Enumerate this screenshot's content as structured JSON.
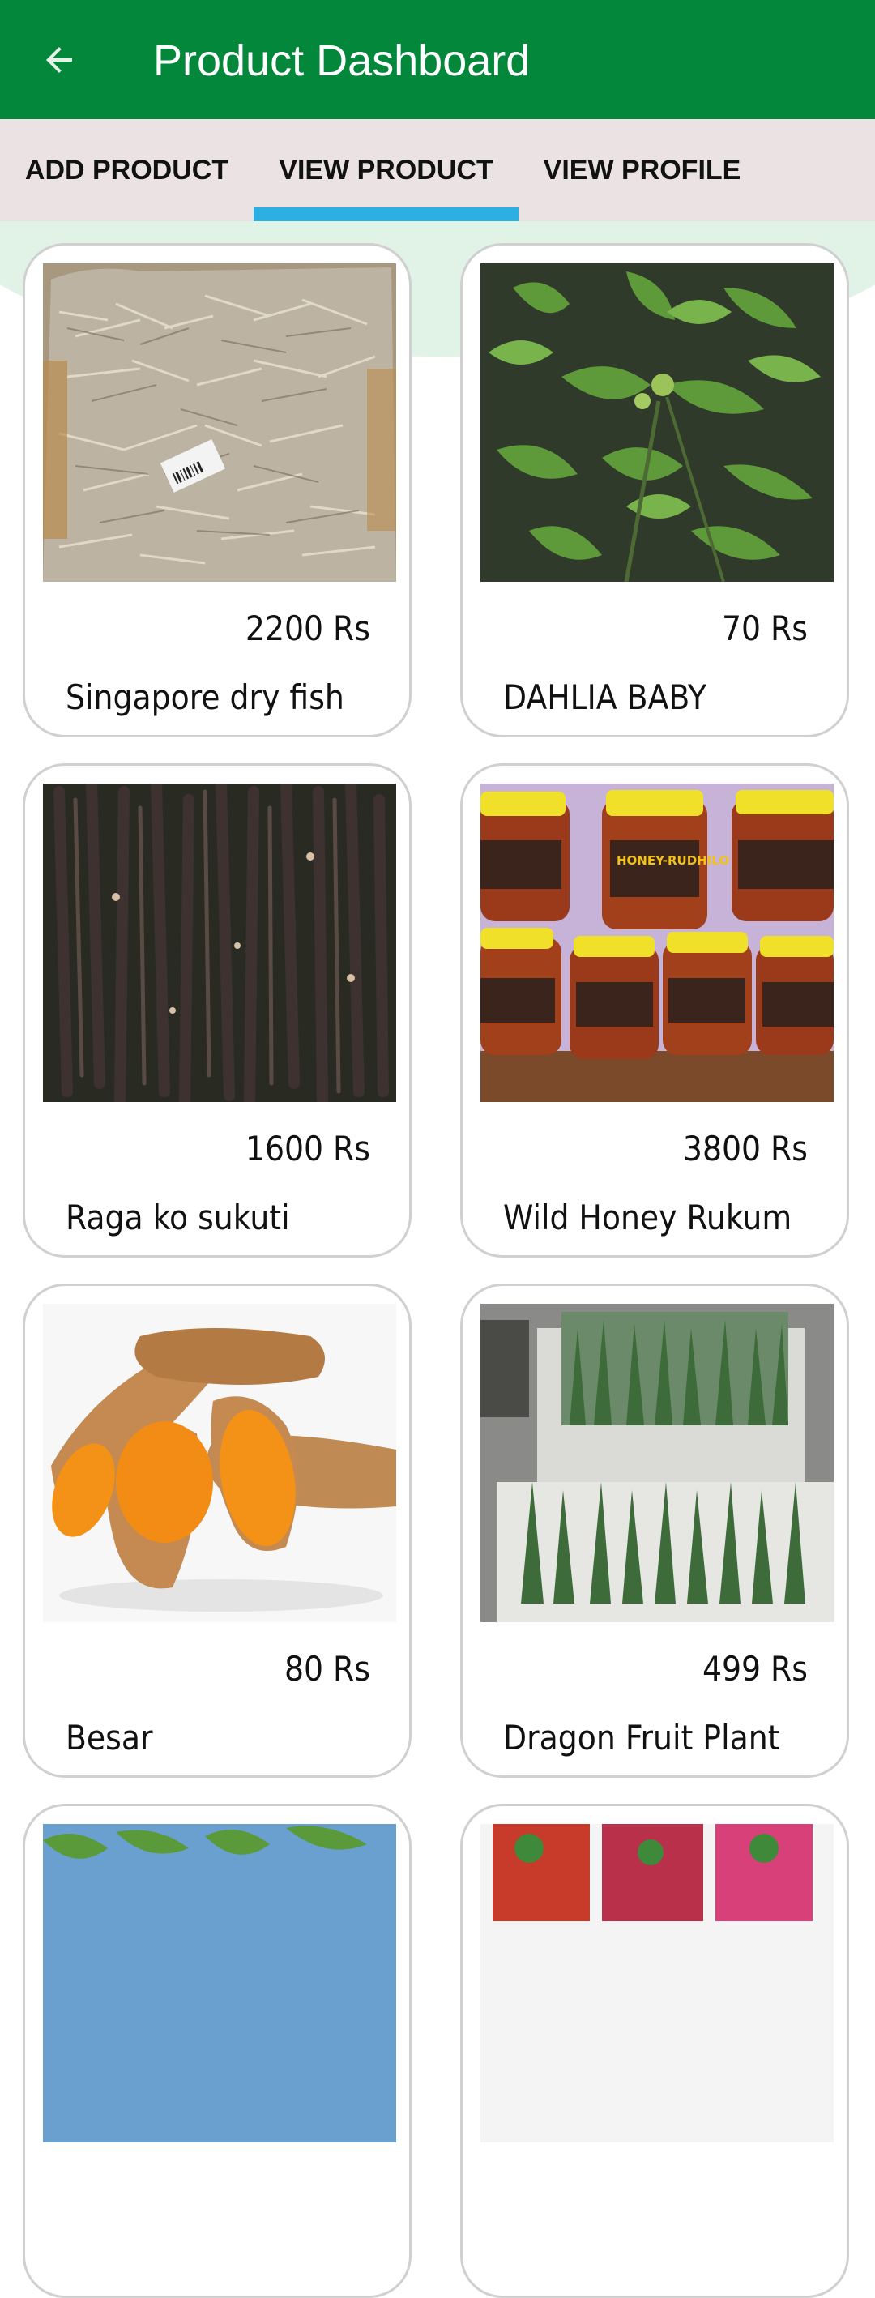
{
  "appbar": {
    "title": "Product Dashboard",
    "back_icon": "arrow-back-icon",
    "background_color": "#03873a"
  },
  "tabs": [
    {
      "label": "ADD PRODUCT",
      "selected": false
    },
    {
      "label": "VIEW PRODUCT",
      "selected": true
    },
    {
      "label": "VIEW PROFILE",
      "selected": false
    }
  ],
  "colors": {
    "tab_indicator": "#2eafe1",
    "tab_bar": "#ebe3e3",
    "background_curve": "#e1f2e7"
  },
  "products": [
    {
      "price": "2200 Rs",
      "name": "Singapore dry fish",
      "image": "dry-fish-bag-photo"
    },
    {
      "price": "70 Rs",
      "name": "DAHLIA BABY",
      "image": "dahlia-plant-photo"
    },
    {
      "price": "1600 Rs",
      "name": "Raga ko sukuti",
      "image": "dried-meat-photo"
    },
    {
      "price": "3800 Rs",
      "name": "Wild Honey Rukum",
      "image": "honey-jars-photo",
      "jar_label": "HONEY-RUDHILO"
    },
    {
      "price": "80 Rs",
      "name": "Besar",
      "image": "turmeric-root-photo"
    },
    {
      "price": "499 Rs",
      "name": "Dragon Fruit Plant",
      "image": "dragon-fruit-plants-photo"
    },
    {
      "price": "",
      "name": "",
      "image": "plant-photo-partial"
    },
    {
      "price": "",
      "name": "",
      "image": "flower-pots-photo-partial"
    }
  ]
}
